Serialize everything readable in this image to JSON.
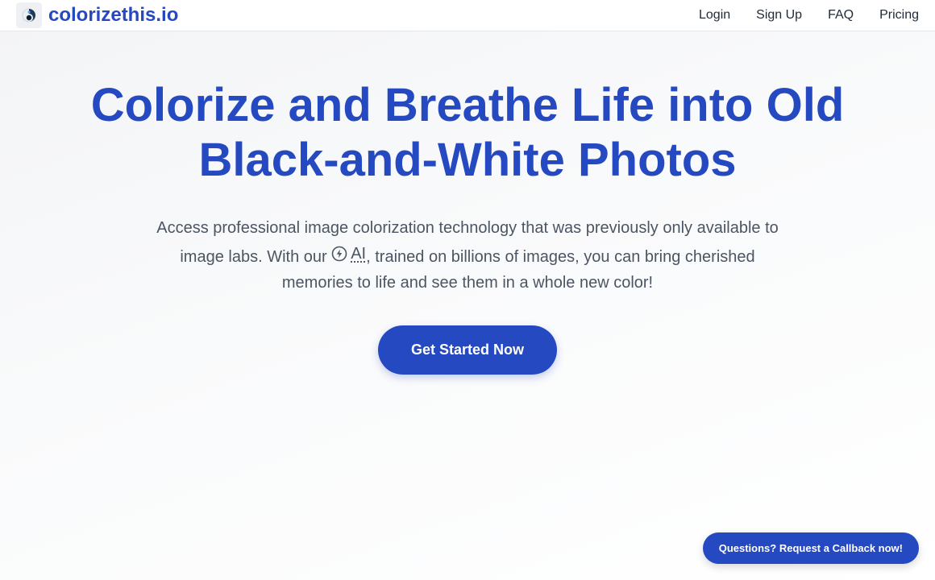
{
  "header": {
    "brand_name": "colorizethis.io",
    "logo_icon": "colorize-logo-icon",
    "nav": [
      {
        "label": "Login"
      },
      {
        "label": "Sign Up"
      },
      {
        "label": "FAQ"
      },
      {
        "label": "Pricing"
      }
    ]
  },
  "hero": {
    "title": "Colorize and Breathe Life into Old Black-and-White Photos",
    "description_before": "Access professional image colorization technology that was previously only available to image labs. With our",
    "ai_term": "AI",
    "ai_icon": "lightning-bolt-icon",
    "description_after": ", trained on billions of images, you can bring cherished memories to life and see them in a whole new color!",
    "cta_label": "Get Started Now"
  },
  "callback": {
    "label": "Questions? Request a Callback now!"
  },
  "colors": {
    "brand": "#2549c0",
    "text": "#1f2937",
    "muted": "#4b5563"
  }
}
